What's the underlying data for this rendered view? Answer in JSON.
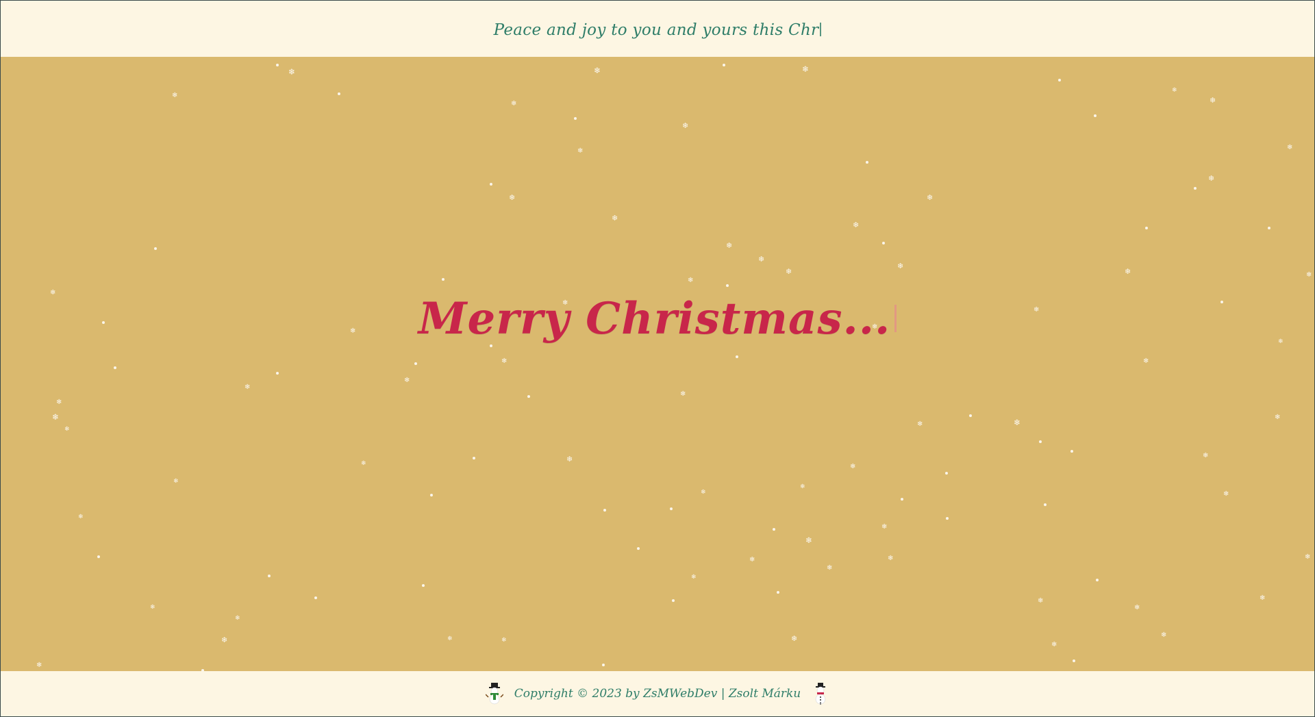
{
  "header": {
    "typing_text": "Peace and joy to you and yours this Chr"
  },
  "greeting": {
    "text": "Merry Christmas..."
  },
  "footer": {
    "copyright": "Copyright © 2023 by ZsMWebDev | Zsolt Márku",
    "left_icon": "snowman-green-icon",
    "right_icon": "snowman-red-icon"
  },
  "colors": {
    "background_stage": "#dab96e",
    "background_bar": "#fdf6e3",
    "header_text": "#2e7d68",
    "greeting_text": "#c8264a",
    "snow": "#ffffff"
  }
}
